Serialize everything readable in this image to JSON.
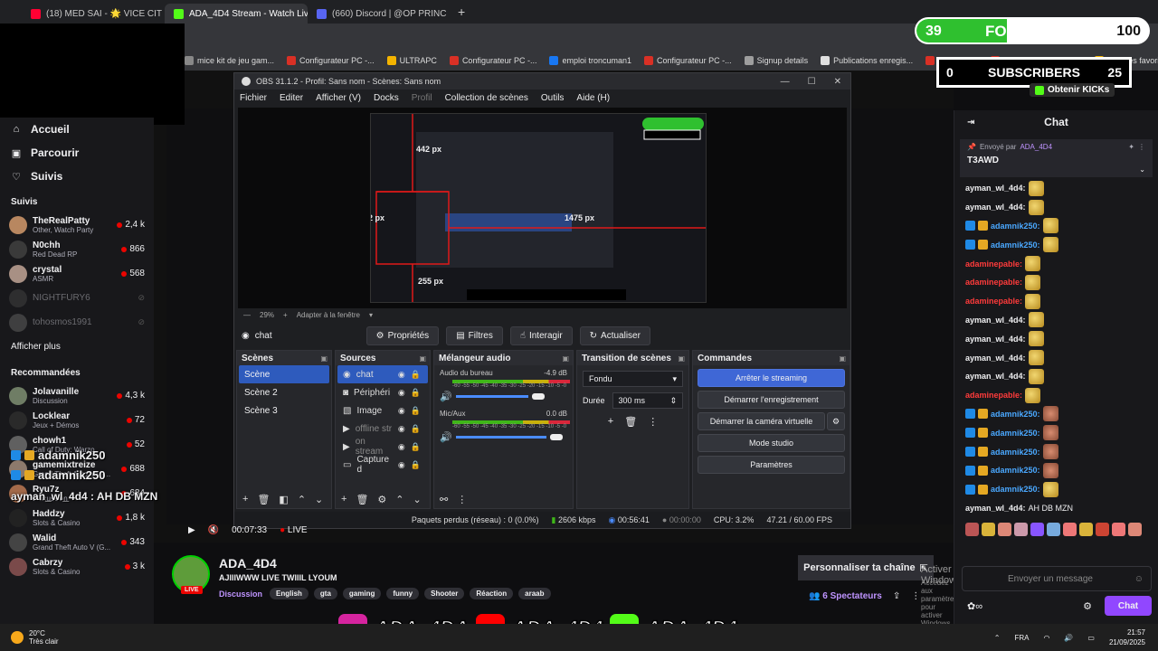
{
  "browser": {
    "tabs": [
      {
        "title": "(18) MED SAI - 🌟 VICE CIT",
        "color": "#ff0033",
        "active": false
      },
      {
        "title": "ADA_4D4 Stream - Watch Live o",
        "color": "#53fc18",
        "active": true
      },
      {
        "title": "(660) Discord | @OP PRINC",
        "color": "#5865f2",
        "active": false
      }
    ],
    "new_tab": "+",
    "bookmarks": [
      {
        "label": "mice kit de jeu gam...",
        "color": "#888888"
      },
      {
        "label": "Configurateur PC -...",
        "color": "#d93025"
      },
      {
        "label": "ULTRAPC",
        "color": "#f4b400"
      },
      {
        "label": "Configurateur PC -...",
        "color": "#d93025"
      },
      {
        "label": "emploi troncuman1",
        "color": "#1877f2"
      },
      {
        "label": "Configurateur PC -...",
        "color": "#d93025"
      },
      {
        "label": "Signup details",
        "color": "#9e9e9e"
      },
      {
        "label": "Publications enregis...",
        "color": "#e0e0e0"
      },
      {
        "label": "جمع 3 ووقر",
        "color": "#d93025"
      },
      {
        "label": "Promo Setup Game...",
        "color": "#d93025"
      },
      {
        "label": "Tous les favoris",
        "color": "#f4b400"
      }
    ]
  },
  "sidebar": {
    "nav": [
      {
        "label": "Accueil",
        "icon": "home-icon",
        "glyph": "⌂"
      },
      {
        "label": "Parcourir",
        "icon": "browse-icon",
        "glyph": "▣"
      },
      {
        "label": "Suivis",
        "icon": "heart-icon",
        "glyph": "♡"
      }
    ],
    "followed_title": "Suivis",
    "followed": [
      {
        "name": "TheRealPatty",
        "game": "Other, Watch Party",
        "viewers": "2,4 k",
        "color": "#b88760"
      },
      {
        "name": "N0chh",
        "game": "Red Dead RP",
        "viewers": "866",
        "color": "#3a3a3a"
      },
      {
        "name": "crystal",
        "game": "ASMR",
        "viewers": "568",
        "color": "#a89084"
      },
      {
        "name": "NIGHTFURY6",
        "offline": true,
        "color": "#444444"
      },
      {
        "name": "tohosmos1991",
        "offline": true,
        "color": "#666666"
      }
    ],
    "show_more": "Afficher plus",
    "recommended_title": "Recommandées",
    "recommended": [
      {
        "name": "Jolavanille",
        "game": "Discussion",
        "viewers": "4,3 k",
        "color": "#6f7d65"
      },
      {
        "name": "Locklear",
        "game": "Jeux + Démos",
        "viewers": "72",
        "color": "#2a2a2a"
      },
      {
        "name": "chowh1",
        "game": "Call of Duty: Warzo",
        "viewers": "52",
        "color": "#606060"
      },
      {
        "name": "gamemixtreize",
        "game": "Grand Theft Auto V (G...",
        "viewers": "688",
        "color": "#8d7a6c"
      },
      {
        "name": "Ryu7z",
        "game": "Discussion",
        "viewers": "684",
        "color": "#a36a4a"
      },
      {
        "name": "Haddzy",
        "game": "Slots & Casino",
        "viewers": "1,8 k",
        "color": "#222222"
      },
      {
        "name": "Walid",
        "game": "Grand Theft Auto V (G...",
        "viewers": "343",
        "color": "#444444"
      },
      {
        "name": "Cabrzy",
        "game": "Slots & Casino",
        "viewers": "3 k",
        "color": "#7a4a4a"
      }
    ]
  },
  "obs": {
    "title": "OBS 31.1.2 - Profil: Sans nom - Scènes: Sans nom",
    "menus": [
      "Fichier",
      "Editer",
      "Afficher (V)",
      "Docks",
      "Profil",
      "Collection de scènes",
      "Outils",
      "Aide (H)"
    ],
    "preview_labels": {
      "top": "442 px",
      "left": "42 px",
      "right": "1475 px",
      "bottom": "255 px"
    },
    "zoom": "29%",
    "fit": "Adapter à la fenêtre",
    "selected_source": "chat",
    "source_buttons": [
      "Propriétés",
      "Filtres",
      "Interagir",
      "Actualiser"
    ],
    "panels": {
      "scenes": "Scènes",
      "sources": "Sources",
      "mixer": "Mélangeur audio",
      "transition": "Transition de scènes",
      "commands": "Commandes"
    },
    "scenes": [
      "Scène",
      "Scène 2",
      "Scène 3"
    ],
    "sources": [
      {
        "name": "chat",
        "icon": "globe-icon",
        "glyph": "◉"
      },
      {
        "name": "Périphéri",
        "icon": "camera-icon",
        "glyph": "◙"
      },
      {
        "name": "Image",
        "icon": "image-icon",
        "glyph": "▧"
      },
      {
        "name": "offline str",
        "icon": "play-icon",
        "glyph": "▶",
        "dim": true
      },
      {
        "name": "on stream",
        "icon": "play-icon",
        "glyph": "▶",
        "dim": true
      },
      {
        "name": "Capture d",
        "icon": "window-icon",
        "glyph": "▭"
      }
    ],
    "mixer": [
      {
        "name": "Audio du bureau",
        "db": "-4.9 dB",
        "level": 0.8
      },
      {
        "name": "Mic/Aux",
        "db": "0.0 dB",
        "level": 1.0
      }
    ],
    "meter_scale": "-60 -55 -50 -45 -40 -35 -30 -25 -20 -15 -10 -5 -0",
    "transition": {
      "type": "Fondu",
      "duration_label": "Durée",
      "duration": "300 ms"
    },
    "commands": [
      "Arrêter le streaming",
      "Démarrer l'enregistrement",
      "Démarrer la caméra virtuelle",
      "Mode studio",
      "Paramètres"
    ],
    "status": {
      "dropped": "Paquets perdus (réseau) : 0 (0.0%)",
      "bitrate": "2606 kbps",
      "stream_time": "00:56:41",
      "rec_time": "00:00:00",
      "cpu": "CPU: 3.2%",
      "fps": "47.21 / 60.00 FPS"
    }
  },
  "player": {
    "time": "00:07:33",
    "live": "LIVE"
  },
  "channel": {
    "name": "ADA_4D4",
    "title": "AJIIIWWW LIVE TWIIIL LYOUM",
    "category": "Discussion",
    "tags": [
      "English",
      "gta",
      "gaming",
      "funny",
      "Shooter",
      "Réaction",
      "araab"
    ],
    "live_badge": "LIVE",
    "customize": "Personnaliser ta chaîne",
    "viewers": "6 Spectateurs",
    "activate1": "Activer Windows",
    "activate2": "Accédez aux paramètres pour activer Windows."
  },
  "overlay": {
    "followers_current": "39",
    "followers_label": "FOLLOWERS",
    "followers_goal": "100",
    "followers_progress": 0.39,
    "subs_current": "0",
    "subs_label": "SUBSCRIBERS",
    "subs_goal": "25",
    "kick_button": "Obtenir KICKs",
    "chat_lines": [
      {
        "text": "adamnik250",
        "size": 13
      },
      {
        "text": "adamnik250",
        "size": 13
      },
      {
        "text": "ayman_wl_4d4 : AH DB MZN",
        "size": 12
      }
    ],
    "socials": [
      {
        "icon": "instagram-icon",
        "handle": "ADA_4DA",
        "color": "#d6249f"
      },
      {
        "icon": "youtube-icon",
        "handle": "ADA_4D4",
        "color": "#ff0000"
      },
      {
        "icon": "kick-icon",
        "handle": "ADA_4D4",
        "color": "#53fc18"
      }
    ]
  },
  "chat": {
    "title": "Chat",
    "pinned_by": "Envoyé par",
    "pinned_user": "ADA_4D4",
    "pinned_msg": "T3AWD",
    "messages": [
      {
        "user": "ayman_wl_4d4:",
        "color": "#efeff1",
        "badges": false,
        "emote": "gold"
      },
      {
        "user": "ayman_wl_4d4:",
        "color": "#efeff1",
        "badges": false,
        "emote": "gold"
      },
      {
        "user": "adamnik250:",
        "color": "#4aa8ff",
        "badges": true,
        "emote": "gold"
      },
      {
        "user": "adamnik250:",
        "color": "#4aa8ff",
        "badges": true,
        "emote": "gold"
      },
      {
        "user": "adaminepable:",
        "color": "#ff3b3b",
        "badges": false,
        "emote": "gold"
      },
      {
        "user": "adaminepable:",
        "color": "#ff3b3b",
        "badges": false,
        "emote": "gold"
      },
      {
        "user": "adaminepable:",
        "color": "#ff3b3b",
        "badges": false,
        "emote": "gold"
      },
      {
        "user": "ayman_wl_4d4:",
        "color": "#efeff1",
        "badges": false,
        "emote": "gold"
      },
      {
        "user": "ayman_wl_4d4:",
        "color": "#efeff1",
        "badges": false,
        "emote": "gold"
      },
      {
        "user": "ayman_wl_4d4:",
        "color": "#efeff1",
        "badges": false,
        "emote": "gold"
      },
      {
        "user": "ayman_wl_4d4:",
        "color": "#efeff1",
        "badges": false,
        "emote": "gold"
      },
      {
        "user": "adaminepable:",
        "color": "#ff3b3b",
        "badges": false,
        "emote": "gold"
      },
      {
        "user": "adamnik250:",
        "color": "#4aa8ff",
        "badges": true,
        "emote": "face"
      },
      {
        "user": "adamnik250:",
        "color": "#4aa8ff",
        "badges": true,
        "emote": "face"
      },
      {
        "user": "adamnik250:",
        "color": "#4aa8ff",
        "badges": true,
        "emote": "face"
      },
      {
        "user": "adamnik250:",
        "color": "#4aa8ff",
        "badges": true,
        "emote": "face"
      },
      {
        "user": "adamnik250:",
        "color": "#4aa8ff",
        "badges": true,
        "emote": "gold"
      }
    ],
    "last_msg_user": "ayman_wl_4d4:",
    "last_msg_text": "AH DB MZN",
    "input_placeholder": "Envoyer un message",
    "send_label": "Chat"
  },
  "taskbar": {
    "temp": "20°C",
    "weather": "Très clair",
    "lang": "FRA",
    "time": "21:57",
    "date": "21/09/2025"
  }
}
